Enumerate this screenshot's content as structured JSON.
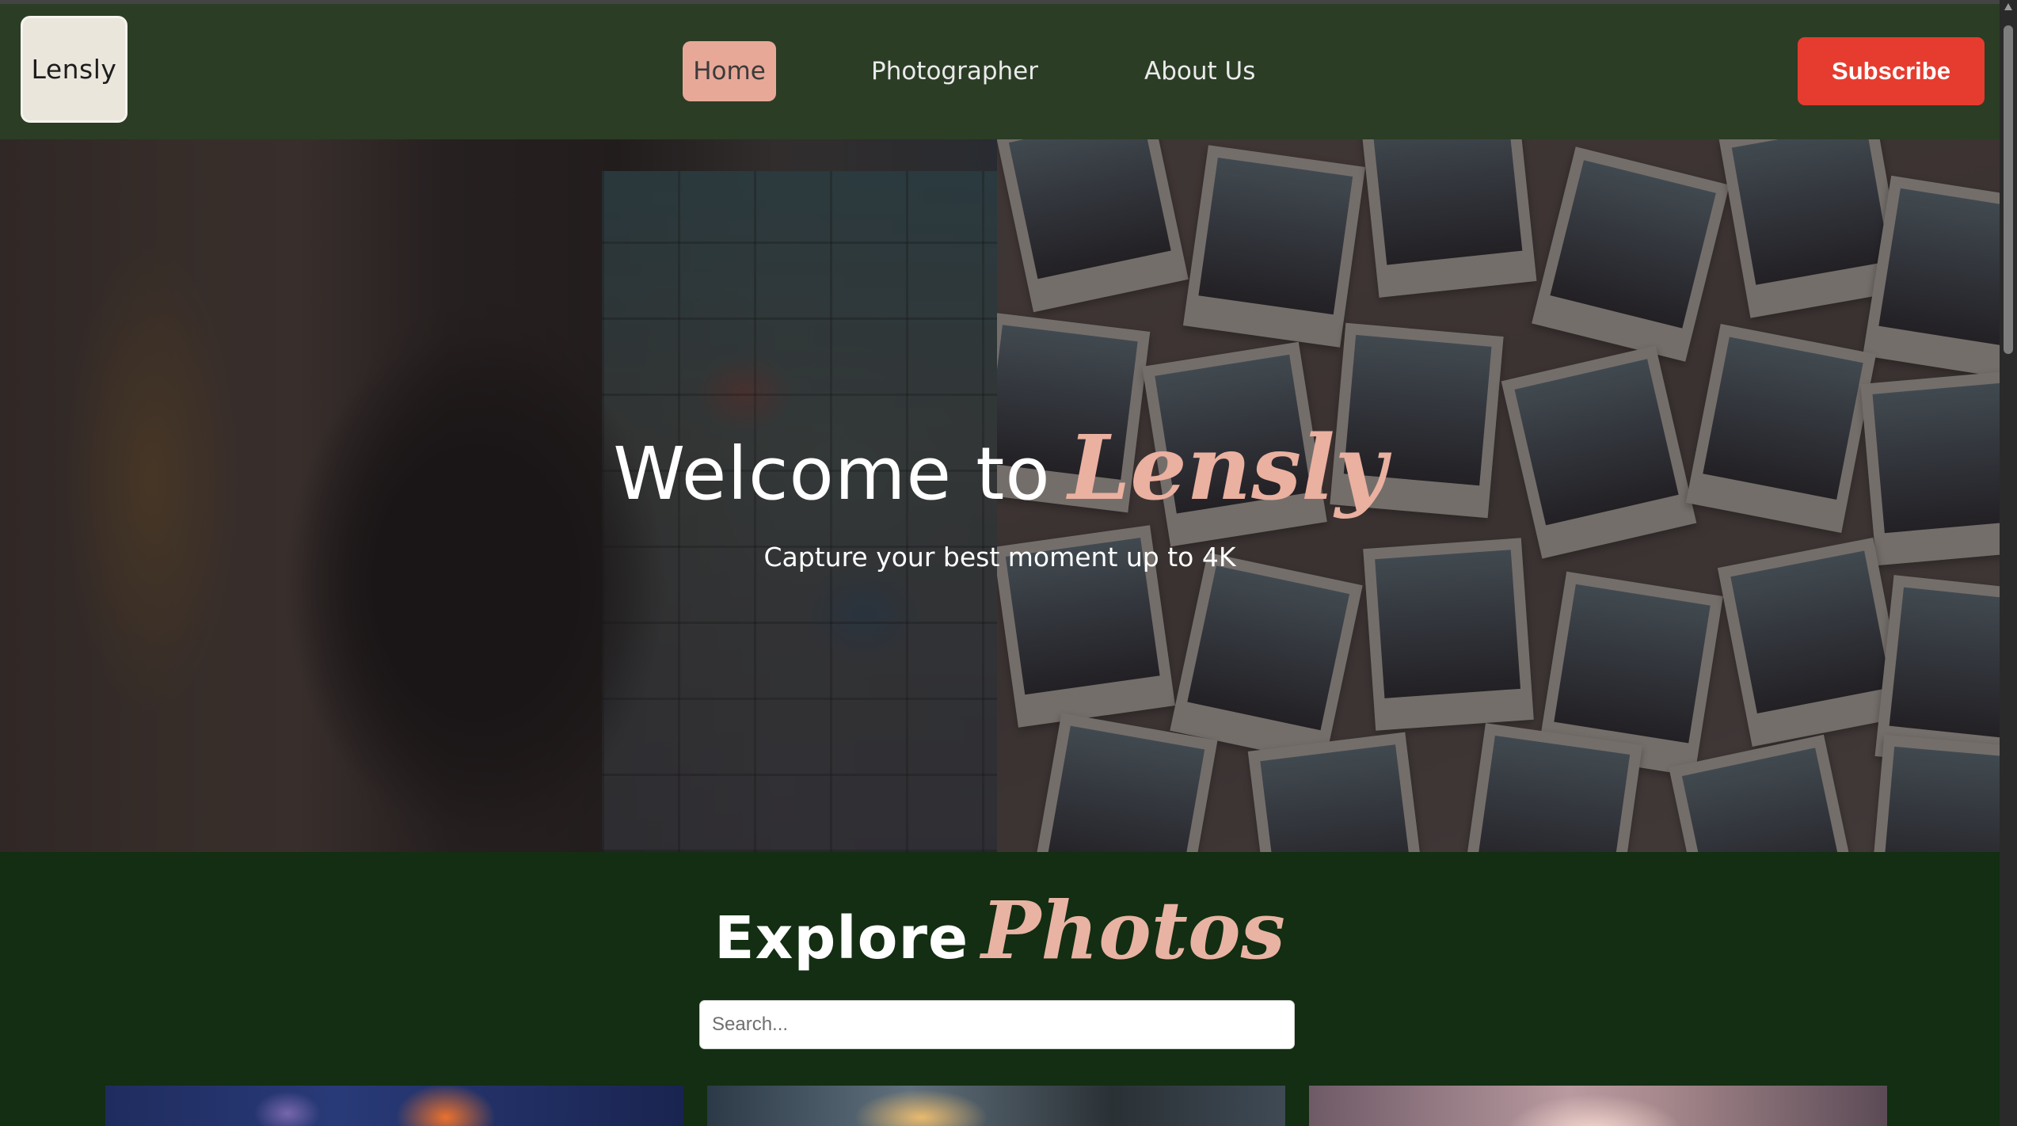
{
  "navbar": {
    "logo_text": "Lensly",
    "links": [
      {
        "label": "Home",
        "active": true
      },
      {
        "label": "Photographer",
        "active": false
      },
      {
        "label": "About Us",
        "active": false
      }
    ],
    "subscribe_label": "Subscribe"
  },
  "hero": {
    "title_main": "Welcome to",
    "title_accent": "Lensly",
    "subtitle": "Capture your best moment up to 4K"
  },
  "explore": {
    "title_main": "Explore",
    "title_accent": "Photos",
    "search_placeholder": "Search..."
  },
  "colors": {
    "navbar_bg": "#2b3d25",
    "active_nav_bg": "#e8a898",
    "subscribe_bg": "#e63c2f",
    "accent_script": "#eab0a0",
    "explore_bg": "#132e12"
  }
}
